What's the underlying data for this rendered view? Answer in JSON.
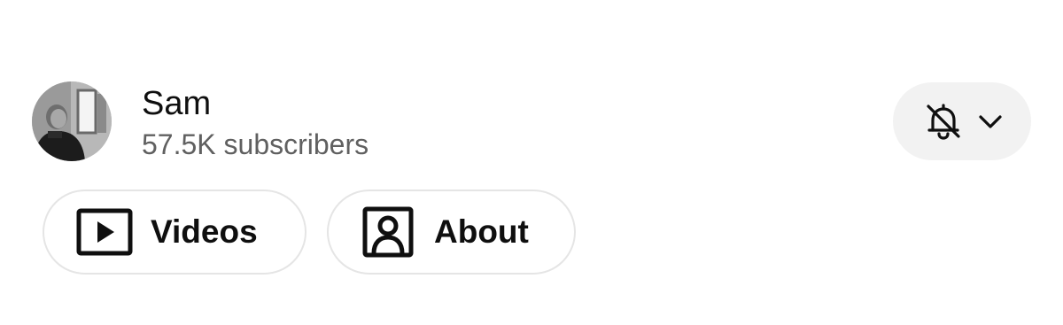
{
  "channel": {
    "name": "Sam",
    "subscribers": "57.5K subscribers"
  },
  "icons": {
    "avatar": "channel-avatar",
    "notify": "bell-off-icon",
    "dropdown": "chevron-down-icon",
    "videos": "play-box-icon",
    "about": "person-box-icon"
  },
  "tabs": [
    {
      "label": "Videos",
      "icon": "play-box-icon"
    },
    {
      "label": "About",
      "icon": "person-box-icon"
    }
  ],
  "colors": {
    "text_primary": "#0f0f0f",
    "text_secondary": "#606060",
    "button_bg": "#f2f2f2",
    "pill_border": "#e5e5e5"
  }
}
